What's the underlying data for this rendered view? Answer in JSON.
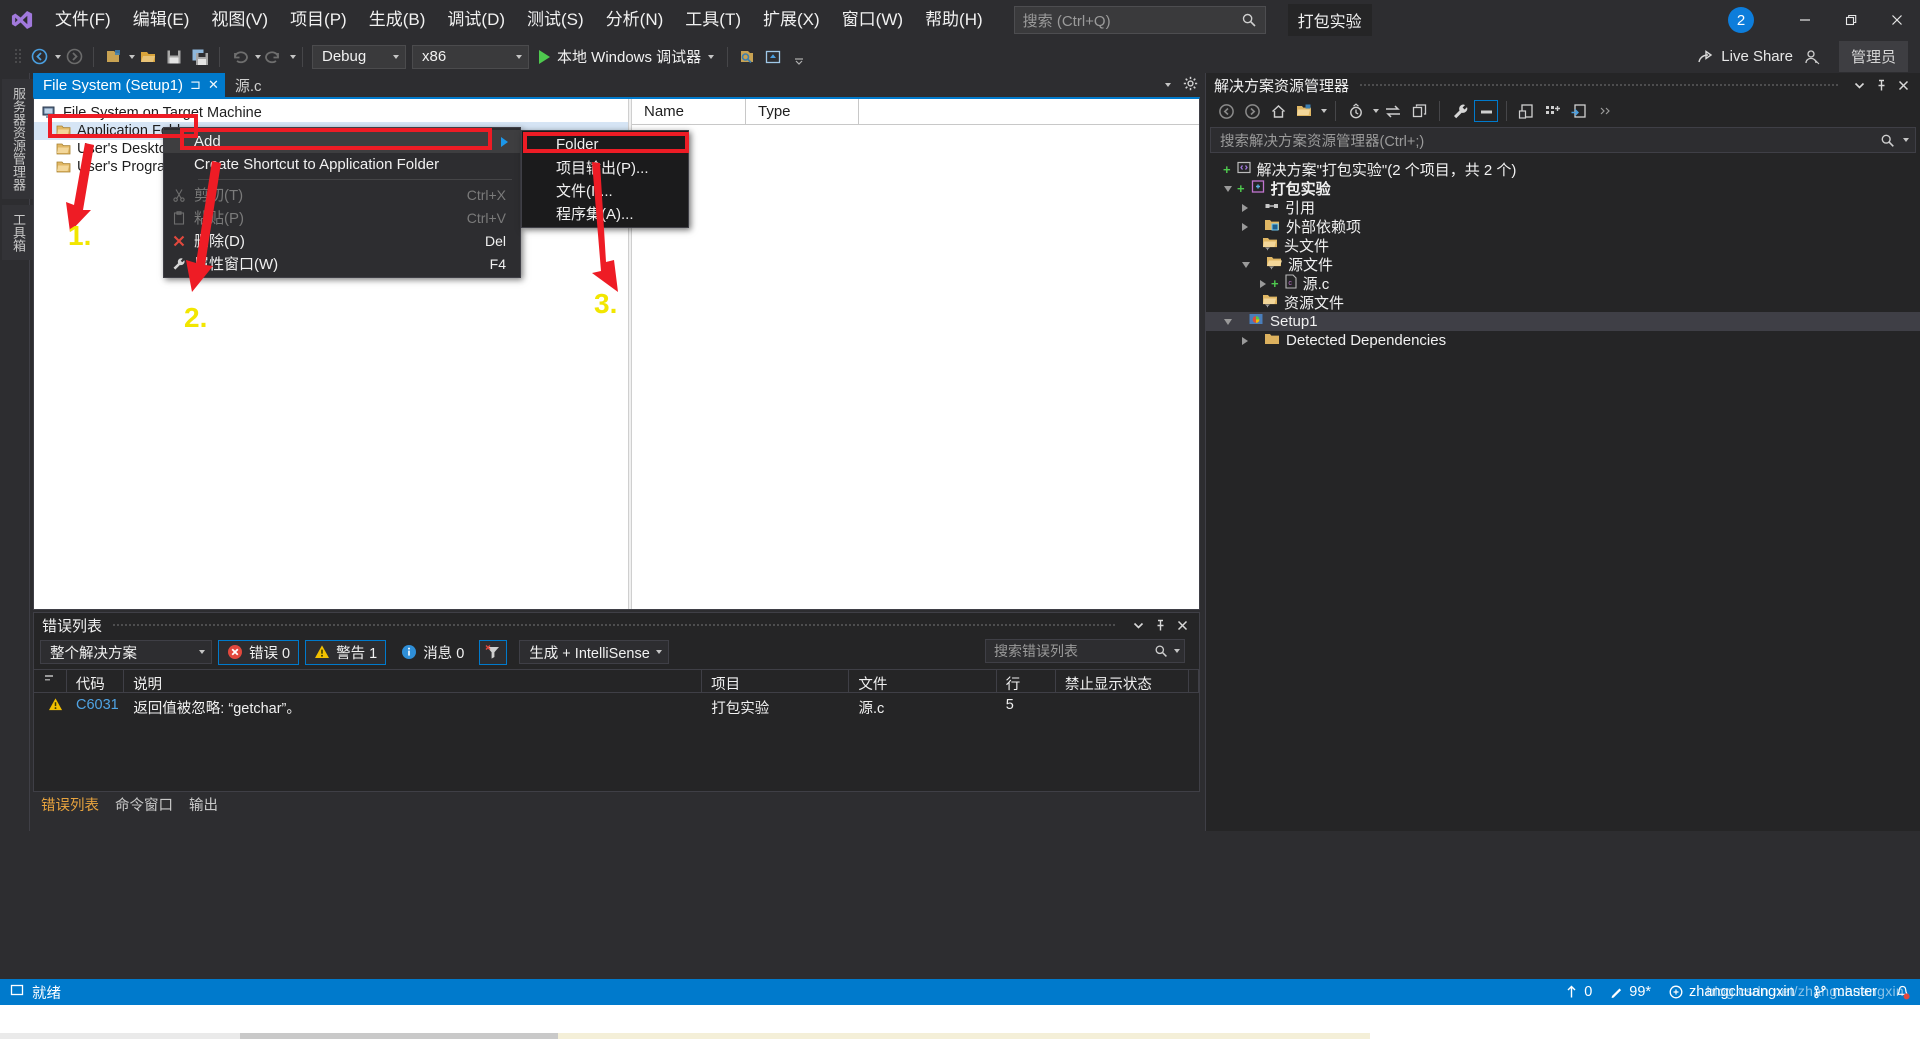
{
  "app": {
    "logo_icon": "visual-studio-logo",
    "solution_name": "打包实验",
    "notification_count": "2",
    "live_share_label": "Live Share",
    "account_label": "管理员"
  },
  "menubar": {
    "items": [
      {
        "label": "文件(F)"
      },
      {
        "label": "编辑(E)"
      },
      {
        "label": "视图(V)"
      },
      {
        "label": "项目(P)"
      },
      {
        "label": "生成(B)"
      },
      {
        "label": "调试(D)"
      },
      {
        "label": "测试(S)"
      },
      {
        "label": "分析(N)"
      },
      {
        "label": "工具(T)"
      },
      {
        "label": "扩展(X)"
      },
      {
        "label": "窗口(W)"
      },
      {
        "label": "帮助(H)"
      }
    ],
    "search_placeholder": "搜索 (Ctrl+Q)"
  },
  "window_controls": {
    "minimize": "—",
    "restore": "❐",
    "close": "✕"
  },
  "toolbar": {
    "config_value": "Debug",
    "platform_value": "x86",
    "debug_target": "本地 Windows 调试器",
    "icons": [
      "navigate-back-icon",
      "navigate-forward-icon",
      "new-project-icon",
      "open-file-icon",
      "save-icon",
      "save-all-icon",
      "undo-icon",
      "redo-icon",
      "start-debug-icon",
      "find-in-files-icon",
      "preview-icon"
    ]
  },
  "left_dock": {
    "tabs": [
      "服务器资源管理器",
      "工具箱"
    ]
  },
  "document_tabs": [
    {
      "label": "File System (Setup1)",
      "active": true,
      "pinned": true,
      "closable": true
    },
    {
      "label": "源.c",
      "active": false,
      "pinned": false,
      "closable": false
    }
  ],
  "designer": {
    "tree": [
      {
        "label": "File System on Target Machine",
        "icon": "computer-icon",
        "indent": 0,
        "selected": false
      },
      {
        "label": "Application Folder",
        "icon": "folder-app-icon",
        "indent": 1,
        "selected": true
      },
      {
        "label": "User's Desktop",
        "icon": "folder-desktop-icon",
        "indent": 1,
        "selected": false
      },
      {
        "label": "User's Programs Menu",
        "icon": "folder-programs-icon",
        "indent": 1,
        "selected": false
      }
    ],
    "grid_columns": [
      "Name",
      "Type"
    ],
    "grid_rows": []
  },
  "context_menu": {
    "items": [
      {
        "label": "Add",
        "shortcut": "",
        "icon": "",
        "submenu": true,
        "highlight": true,
        "disabled": false
      },
      {
        "label": "Create Shortcut to Application Folder",
        "shortcut": "",
        "icon": "",
        "submenu": false,
        "highlight": false,
        "disabled": false
      },
      {
        "separator": true
      },
      {
        "label": "剪切(T)",
        "shortcut": "Ctrl+X",
        "icon": "cut-icon",
        "submenu": false,
        "highlight": false,
        "disabled": true
      },
      {
        "label": "粘贴(P)",
        "shortcut": "Ctrl+V",
        "icon": "paste-icon",
        "submenu": false,
        "highlight": false,
        "disabled": true
      },
      {
        "label": "删除(D)",
        "shortcut": "Del",
        "icon": "delete-icon",
        "submenu": false,
        "highlight": false,
        "disabled": false
      },
      {
        "label": "属性窗口(W)",
        "shortcut": "F4",
        "icon": "properties-icon",
        "submenu": false,
        "highlight": false,
        "disabled": false
      }
    ]
  },
  "submenu": {
    "items": [
      {
        "label": "Folder",
        "highlight": true
      },
      {
        "label": "项目输出(P)...",
        "highlight": false
      },
      {
        "label": "文件(I)...",
        "highlight": false
      },
      {
        "label": "程序集(A)...",
        "highlight": false
      }
    ]
  },
  "annotations": {
    "step1": "1.",
    "step2": "2.",
    "step3": "3.",
    "highlight_color": "#ee1c25",
    "number_color": "#f2e600"
  },
  "solution_explorer": {
    "title": "解决方案资源管理器",
    "search_placeholder": "搜索解决方案资源管理器(Ctrl+;)",
    "header_icons": [
      "chevron-down-icon",
      "pin-icon",
      "close-icon"
    ],
    "toolbar_icons": [
      "back-icon",
      "forward-icon",
      "home-icon",
      "sync-with-active-document-icon",
      "chevron-down-icon",
      "pending-changes-icon",
      "refresh-icon",
      "collapse-all-icon",
      "properties-icon",
      "show-all-files-icon",
      "preview-selected-items-icon",
      "new-folder-icon",
      "view-code-icon",
      "toggle-icon"
    ],
    "tree": [
      {
        "label": "解决方案\"打包实验\"(2 个项目，共 2 个)",
        "icon": "solution-icon",
        "indent": 0,
        "expander": "none",
        "state": "normal"
      },
      {
        "label": "打包实验",
        "icon": "cpp-project-icon",
        "indent": 1,
        "expander": "down",
        "state": "bold"
      },
      {
        "label": "引用",
        "icon": "references-icon",
        "indent": 2,
        "expander": "right",
        "state": "normal"
      },
      {
        "label": "外部依赖项",
        "icon": "external-deps-icon",
        "indent": 2,
        "expander": "right",
        "state": "normal"
      },
      {
        "label": "头文件",
        "icon": "filter-folder-icon",
        "indent": 2,
        "expander": "none",
        "state": "normal"
      },
      {
        "label": "源文件",
        "icon": "filter-folder-open-icon",
        "indent": 2,
        "expander": "down",
        "state": "normal"
      },
      {
        "label": "源.c",
        "icon": "c-file-icon",
        "indent": 3,
        "expander": "right",
        "state": "normal"
      },
      {
        "label": "资源文件",
        "icon": "filter-folder-icon",
        "indent": 2,
        "expander": "none",
        "state": "normal"
      },
      {
        "label": "Setup1",
        "icon": "setup-project-icon",
        "indent": 1,
        "expander": "down",
        "state": "selected"
      },
      {
        "label": "Detected Dependencies",
        "icon": "folder-icon",
        "indent": 2,
        "expander": "right",
        "state": "normal"
      }
    ]
  },
  "error_list": {
    "title": "错误列表",
    "scope_value": "整个解决方案",
    "errors_label": "错误 0",
    "warnings_label": "警告 1",
    "messages_label": "消息 0",
    "filter_icon": "clear-filter-icon",
    "build_filter_value": "生成 + IntelliSense",
    "search_placeholder": "搜索错误列表",
    "columns": [
      "",
      "",
      "代码",
      "说明",
      "项目",
      "文件",
      "行",
      "禁止显示状态",
      ""
    ],
    "rows": [
      {
        "severity": "warning",
        "code": "C6031",
        "description": "返回值被忽略: “getchar”。",
        "project": "打包实验",
        "file": "源.c",
        "line": "5",
        "suppression": ""
      }
    ],
    "tabs": [
      {
        "label": "错误列表",
        "active": true
      },
      {
        "label": "命令窗口",
        "active": false
      },
      {
        "label": "输出",
        "active": false
      }
    ]
  },
  "status_bar": {
    "ready": "就绪",
    "ready_icon": "ready-icon",
    "up_count": "0",
    "up_icon": "up-arrow-icon",
    "pen_value": "99*",
    "pen_icon": "pencil-icon",
    "user": "zhangchuangxin",
    "user_icon": "source-control-icon",
    "branch": "master",
    "branch_icon": "branch-icon",
    "notification_icon": "notification-bell-icon"
  },
  "watermark": "blog.csdn.net/zhangchuangxin"
}
